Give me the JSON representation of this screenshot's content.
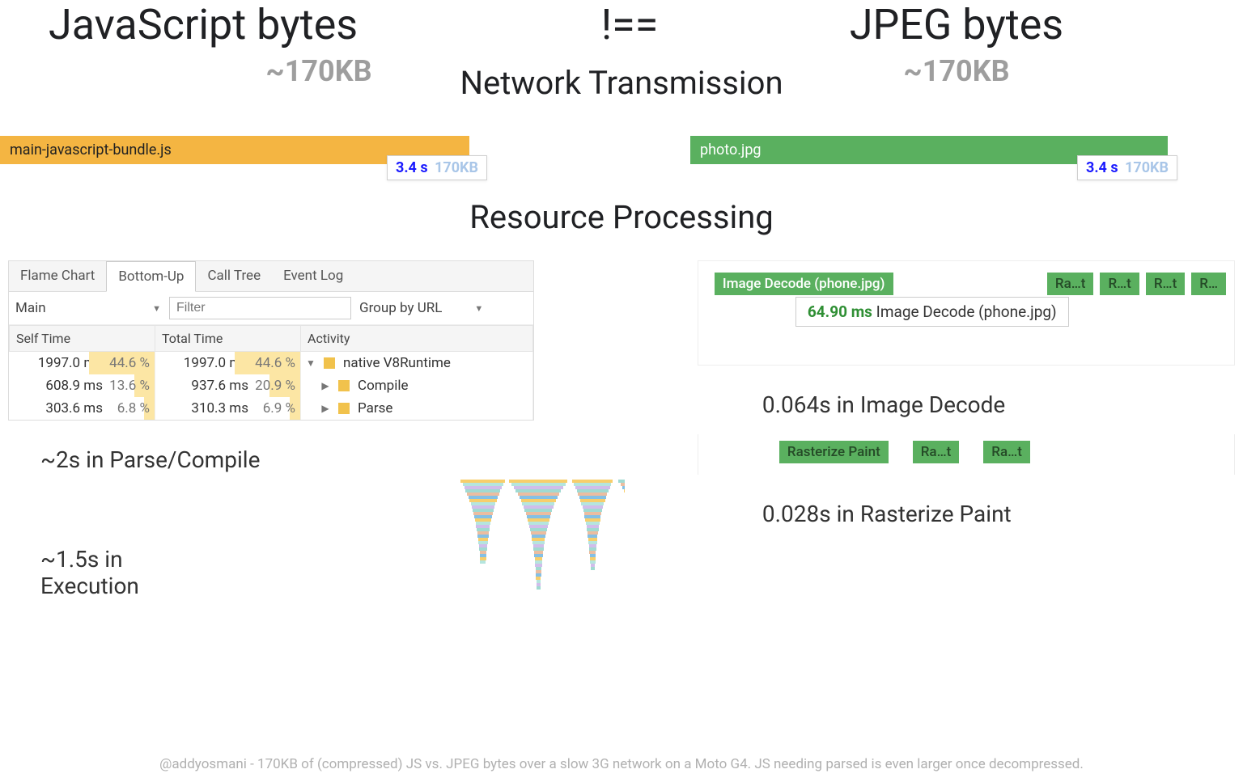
{
  "header": {
    "left_title": "JavaScript bytes",
    "right_title": "JPEG bytes",
    "neq": "!==",
    "left_size": "~170KB",
    "right_size": "~170KB"
  },
  "sections": {
    "network": "Network Transmission",
    "processing": "Resource Processing"
  },
  "network": {
    "js_filename": "main-javascript-bundle.js",
    "jpeg_filename": "photo.jpg",
    "tooltip_time": "3.4 s",
    "tooltip_size": "170KB"
  },
  "devtools": {
    "tabs": [
      "Flame Chart",
      "Bottom-Up",
      "Call Tree",
      "Event Log"
    ],
    "active_tab": "Bottom-Up",
    "thread": "Main",
    "filter_placeholder": "Filter",
    "group_label": "Group by URL",
    "columns": [
      "Self Time",
      "Total Time",
      "Activity"
    ],
    "rows": [
      {
        "self_ms": "1997.0 ms",
        "self_pct": "44.6 %",
        "total_ms": "1997.0 ms",
        "total_pct": "44.6 %",
        "activity": "native V8Runtime",
        "expanded": true
      },
      {
        "self_ms": "608.9 ms",
        "self_pct": "13.6 %",
        "total_ms": "937.6 ms",
        "total_pct": "20.9 %",
        "activity": "Compile",
        "expanded": false
      },
      {
        "self_ms": "303.6 ms",
        "self_pct": "6.8 %",
        "total_ms": "310.3 ms",
        "total_pct": "6.9 %",
        "activity": "Parse",
        "expanded": false
      }
    ]
  },
  "summaries": {
    "parse_compile": "~2s in Parse/Compile",
    "execution": "~1.5s in Execution",
    "image_decode": "0.064s in Image Decode",
    "raster_paint": "0.028s in Rasterize Paint"
  },
  "decode": {
    "main_pill": "Image Decode (phone.jpg)",
    "mini_pills": [
      "Ra…t",
      "R…t",
      "R…t",
      "R…"
    ],
    "tooltip_ms": "64.90 ms",
    "tooltip_label": "Image Decode (phone.jpg)"
  },
  "raster": {
    "pills": [
      "Rasterize Paint",
      "Ra…t",
      "Ra…t"
    ]
  },
  "footer": "@addyosmani - 170KB of (compressed) JS vs. JPEG bytes over a slow 3G network on a Moto G4. JS needing parsed is even larger once decompressed."
}
